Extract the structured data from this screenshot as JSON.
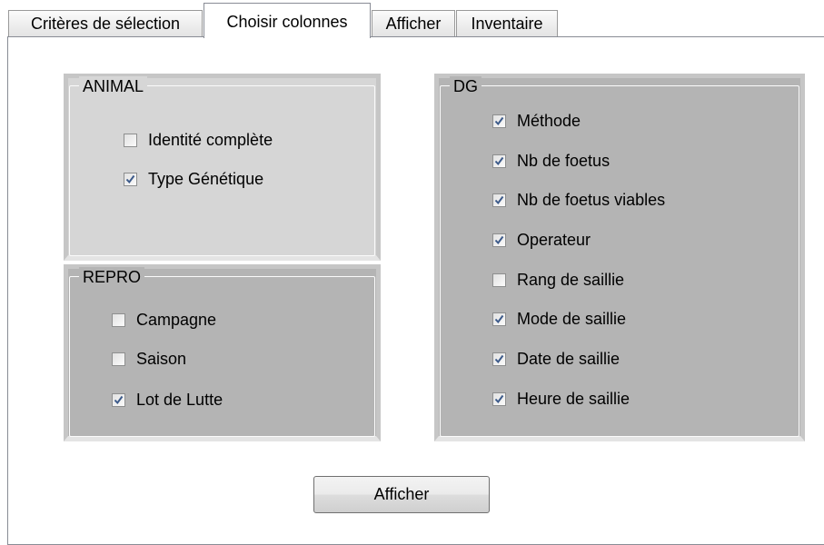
{
  "tabs": [
    {
      "label": "Critères de sélection"
    },
    {
      "label": "Choisir colonnes"
    },
    {
      "label": "Afficher"
    },
    {
      "label": "Inventaire"
    }
  ],
  "active_tab": "Choisir colonnes",
  "groups": {
    "animal": {
      "title": "ANIMAL",
      "items": [
        {
          "label": "Identité complète",
          "checked": false
        },
        {
          "label": "Type Génétique",
          "checked": true
        }
      ]
    },
    "repro": {
      "title": "REPRO",
      "items": [
        {
          "label": "Campagne",
          "checked": false
        },
        {
          "label": "Saison",
          "checked": false
        },
        {
          "label": "Lot de Lutte",
          "checked": true
        }
      ]
    },
    "dg": {
      "title": "DG",
      "items": [
        {
          "label": "Méthode",
          "checked": true
        },
        {
          "label": "Nb de foetus",
          "checked": true
        },
        {
          "label": "Nb de foetus viables",
          "checked": true
        },
        {
          "label": "Operateur",
          "checked": true
        },
        {
          "label": "Rang de saillie",
          "checked": false
        },
        {
          "label": "Mode de saillie",
          "checked": true
        },
        {
          "label": "Date de saillie",
          "checked": true
        },
        {
          "label": "Heure de saillie",
          "checked": true
        }
      ]
    }
  },
  "buttons": {
    "show_label": "Afficher"
  },
  "colors": {
    "group_animal_bg": "#d6d6d6",
    "group_bg": "#b4b4b4",
    "check_mark": "#3c5a8a"
  }
}
